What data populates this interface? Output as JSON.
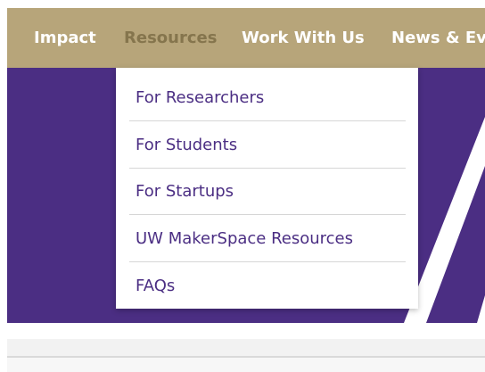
{
  "colors": {
    "gold": "#b7a57a",
    "gold_dark": "#85754d",
    "purple": "#4b2e83",
    "white": "#ffffff"
  },
  "nav": {
    "items": [
      {
        "label": "Impact",
        "active": false
      },
      {
        "label": "Resources",
        "active": true
      },
      {
        "label": "Work With Us",
        "active": false
      },
      {
        "label": "News & Eve",
        "active": false
      }
    ]
  },
  "dropdown": {
    "items": [
      {
        "label": "For Researchers"
      },
      {
        "label": "For Students"
      },
      {
        "label": "For Startups"
      },
      {
        "label": "UW MakerSpace Resources"
      },
      {
        "label": "FAQs"
      }
    ]
  }
}
